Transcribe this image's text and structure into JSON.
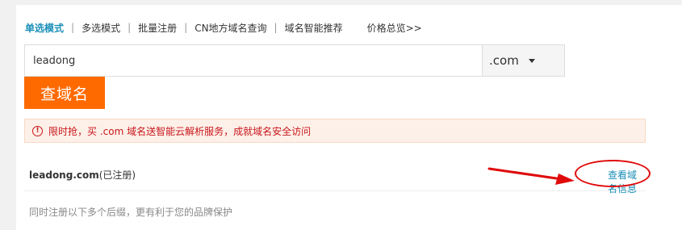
{
  "tabs": {
    "items": [
      {
        "label": "单选模式",
        "active": true
      },
      {
        "label": "多选模式",
        "active": false
      },
      {
        "label": "批量注册",
        "active": false
      },
      {
        "label": "CN地方域名查询",
        "active": false
      },
      {
        "label": "域名智能推荐",
        "active": false
      }
    ],
    "separator": "|",
    "more": "价格总览>>"
  },
  "search": {
    "value": "leadong",
    "suffix": ".com",
    "button_label": "查域名"
  },
  "notice": {
    "icon": "!",
    "text": "限时抢，买 .com 域名送智能云解析服务，成就域名安全访问"
  },
  "result": {
    "domain": "leadong.com",
    "status": "(已注册)",
    "link_label": "查看域名信息"
  },
  "suggest": {
    "text": "同时注册以下多个后缀，更有利于您的品牌保护"
  },
  "colors": {
    "accent": "#1a8fb8",
    "button": "#ff6a00",
    "annotation": "#e00a0a",
    "notice_bg": "#fdf0e8"
  }
}
